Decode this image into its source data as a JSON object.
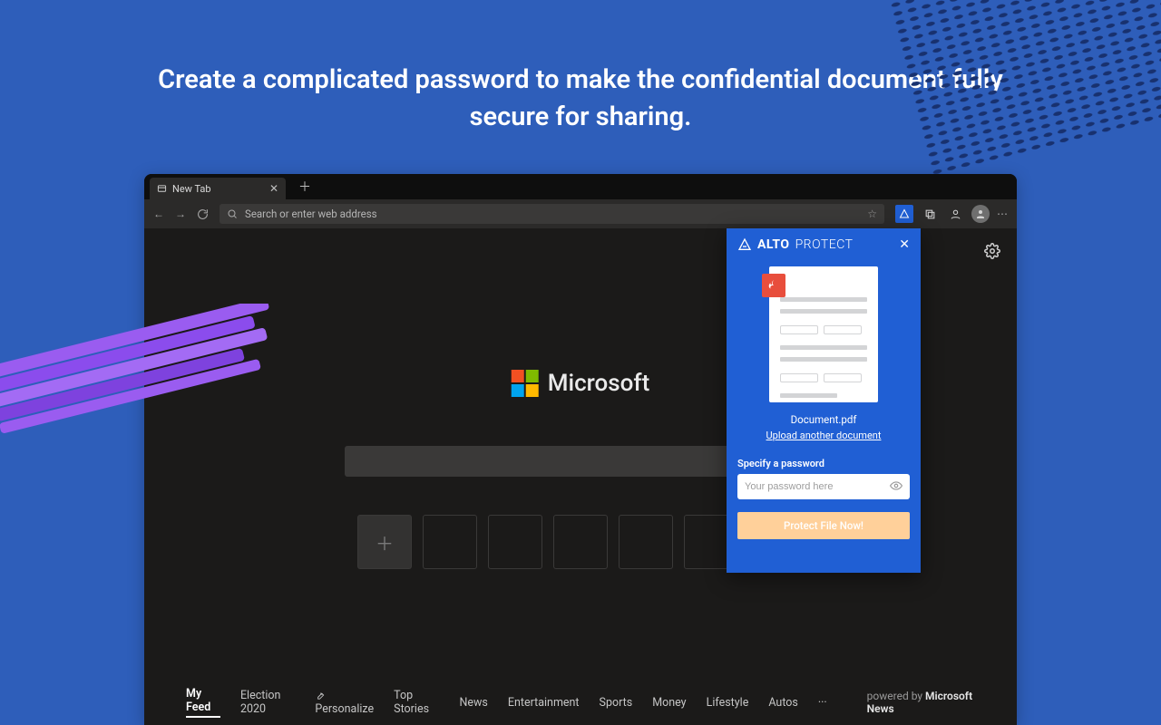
{
  "headline": "Create a complicated password to make the confidential document fully secure for sharing.",
  "browser": {
    "tab_title": "New Tab",
    "url_placeholder": "Search or enter web address",
    "ms_brand": "Microsoft",
    "nav": {
      "items": [
        "My Feed",
        "Election 2020",
        "Personalize",
        "Top Stories",
        "News",
        "Entertainment",
        "Sports",
        "Money",
        "Lifestyle",
        "Autos"
      ],
      "active_index": 0,
      "more": "···"
    },
    "powered_prefix": "powered by ",
    "powered_brand": "Microsoft News"
  },
  "panel": {
    "brand_bold": "ALTO",
    "brand_light": "PROTECT",
    "file_name": "Document.pdf",
    "upload_link": "Upload another document",
    "pw_label": "Specify a password",
    "pw_placeholder": "Your password here",
    "button": "Protect File Now!"
  }
}
